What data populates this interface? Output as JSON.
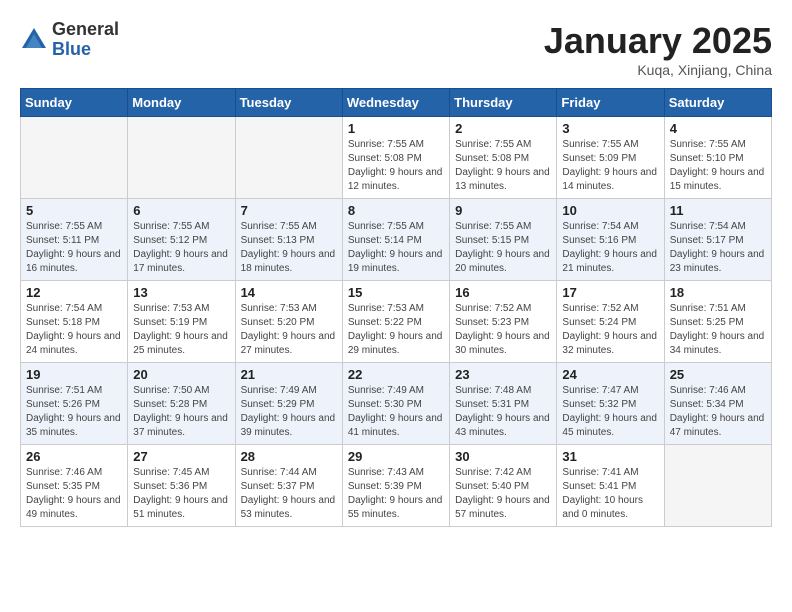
{
  "logo": {
    "general": "General",
    "blue": "Blue"
  },
  "title": "January 2025",
  "location": "Kuqa, Xinjiang, China",
  "days_of_week": [
    "Sunday",
    "Monday",
    "Tuesday",
    "Wednesday",
    "Thursday",
    "Friday",
    "Saturday"
  ],
  "weeks": [
    [
      {
        "day": "",
        "sunrise": "",
        "sunset": "",
        "daylight": ""
      },
      {
        "day": "",
        "sunrise": "",
        "sunset": "",
        "daylight": ""
      },
      {
        "day": "",
        "sunrise": "",
        "sunset": "",
        "daylight": ""
      },
      {
        "day": "1",
        "sunrise": "Sunrise: 7:55 AM",
        "sunset": "Sunset: 5:08 PM",
        "daylight": "Daylight: 9 hours and 12 minutes."
      },
      {
        "day": "2",
        "sunrise": "Sunrise: 7:55 AM",
        "sunset": "Sunset: 5:08 PM",
        "daylight": "Daylight: 9 hours and 13 minutes."
      },
      {
        "day": "3",
        "sunrise": "Sunrise: 7:55 AM",
        "sunset": "Sunset: 5:09 PM",
        "daylight": "Daylight: 9 hours and 14 minutes."
      },
      {
        "day": "4",
        "sunrise": "Sunrise: 7:55 AM",
        "sunset": "Sunset: 5:10 PM",
        "daylight": "Daylight: 9 hours and 15 minutes."
      }
    ],
    [
      {
        "day": "5",
        "sunrise": "Sunrise: 7:55 AM",
        "sunset": "Sunset: 5:11 PM",
        "daylight": "Daylight: 9 hours and 16 minutes."
      },
      {
        "day": "6",
        "sunrise": "Sunrise: 7:55 AM",
        "sunset": "Sunset: 5:12 PM",
        "daylight": "Daylight: 9 hours and 17 minutes."
      },
      {
        "day": "7",
        "sunrise": "Sunrise: 7:55 AM",
        "sunset": "Sunset: 5:13 PM",
        "daylight": "Daylight: 9 hours and 18 minutes."
      },
      {
        "day": "8",
        "sunrise": "Sunrise: 7:55 AM",
        "sunset": "Sunset: 5:14 PM",
        "daylight": "Daylight: 9 hours and 19 minutes."
      },
      {
        "day": "9",
        "sunrise": "Sunrise: 7:55 AM",
        "sunset": "Sunset: 5:15 PM",
        "daylight": "Daylight: 9 hours and 20 minutes."
      },
      {
        "day": "10",
        "sunrise": "Sunrise: 7:54 AM",
        "sunset": "Sunset: 5:16 PM",
        "daylight": "Daylight: 9 hours and 21 minutes."
      },
      {
        "day": "11",
        "sunrise": "Sunrise: 7:54 AM",
        "sunset": "Sunset: 5:17 PM",
        "daylight": "Daylight: 9 hours and 23 minutes."
      }
    ],
    [
      {
        "day": "12",
        "sunrise": "Sunrise: 7:54 AM",
        "sunset": "Sunset: 5:18 PM",
        "daylight": "Daylight: 9 hours and 24 minutes."
      },
      {
        "day": "13",
        "sunrise": "Sunrise: 7:53 AM",
        "sunset": "Sunset: 5:19 PM",
        "daylight": "Daylight: 9 hours and 25 minutes."
      },
      {
        "day": "14",
        "sunrise": "Sunrise: 7:53 AM",
        "sunset": "Sunset: 5:20 PM",
        "daylight": "Daylight: 9 hours and 27 minutes."
      },
      {
        "day": "15",
        "sunrise": "Sunrise: 7:53 AM",
        "sunset": "Sunset: 5:22 PM",
        "daylight": "Daylight: 9 hours and 29 minutes."
      },
      {
        "day": "16",
        "sunrise": "Sunrise: 7:52 AM",
        "sunset": "Sunset: 5:23 PM",
        "daylight": "Daylight: 9 hours and 30 minutes."
      },
      {
        "day": "17",
        "sunrise": "Sunrise: 7:52 AM",
        "sunset": "Sunset: 5:24 PM",
        "daylight": "Daylight: 9 hours and 32 minutes."
      },
      {
        "day": "18",
        "sunrise": "Sunrise: 7:51 AM",
        "sunset": "Sunset: 5:25 PM",
        "daylight": "Daylight: 9 hours and 34 minutes."
      }
    ],
    [
      {
        "day": "19",
        "sunrise": "Sunrise: 7:51 AM",
        "sunset": "Sunset: 5:26 PM",
        "daylight": "Daylight: 9 hours and 35 minutes."
      },
      {
        "day": "20",
        "sunrise": "Sunrise: 7:50 AM",
        "sunset": "Sunset: 5:28 PM",
        "daylight": "Daylight: 9 hours and 37 minutes."
      },
      {
        "day": "21",
        "sunrise": "Sunrise: 7:49 AM",
        "sunset": "Sunset: 5:29 PM",
        "daylight": "Daylight: 9 hours and 39 minutes."
      },
      {
        "day": "22",
        "sunrise": "Sunrise: 7:49 AM",
        "sunset": "Sunset: 5:30 PM",
        "daylight": "Daylight: 9 hours and 41 minutes."
      },
      {
        "day": "23",
        "sunrise": "Sunrise: 7:48 AM",
        "sunset": "Sunset: 5:31 PM",
        "daylight": "Daylight: 9 hours and 43 minutes."
      },
      {
        "day": "24",
        "sunrise": "Sunrise: 7:47 AM",
        "sunset": "Sunset: 5:32 PM",
        "daylight": "Daylight: 9 hours and 45 minutes."
      },
      {
        "day": "25",
        "sunrise": "Sunrise: 7:46 AM",
        "sunset": "Sunset: 5:34 PM",
        "daylight": "Daylight: 9 hours and 47 minutes."
      }
    ],
    [
      {
        "day": "26",
        "sunrise": "Sunrise: 7:46 AM",
        "sunset": "Sunset: 5:35 PM",
        "daylight": "Daylight: 9 hours and 49 minutes."
      },
      {
        "day": "27",
        "sunrise": "Sunrise: 7:45 AM",
        "sunset": "Sunset: 5:36 PM",
        "daylight": "Daylight: 9 hours and 51 minutes."
      },
      {
        "day": "28",
        "sunrise": "Sunrise: 7:44 AM",
        "sunset": "Sunset: 5:37 PM",
        "daylight": "Daylight: 9 hours and 53 minutes."
      },
      {
        "day": "29",
        "sunrise": "Sunrise: 7:43 AM",
        "sunset": "Sunset: 5:39 PM",
        "daylight": "Daylight: 9 hours and 55 minutes."
      },
      {
        "day": "30",
        "sunrise": "Sunrise: 7:42 AM",
        "sunset": "Sunset: 5:40 PM",
        "daylight": "Daylight: 9 hours and 57 minutes."
      },
      {
        "day": "31",
        "sunrise": "Sunrise: 7:41 AM",
        "sunset": "Sunset: 5:41 PM",
        "daylight": "Daylight: 10 hours and 0 minutes."
      },
      {
        "day": "",
        "sunrise": "",
        "sunset": "",
        "daylight": ""
      }
    ]
  ]
}
